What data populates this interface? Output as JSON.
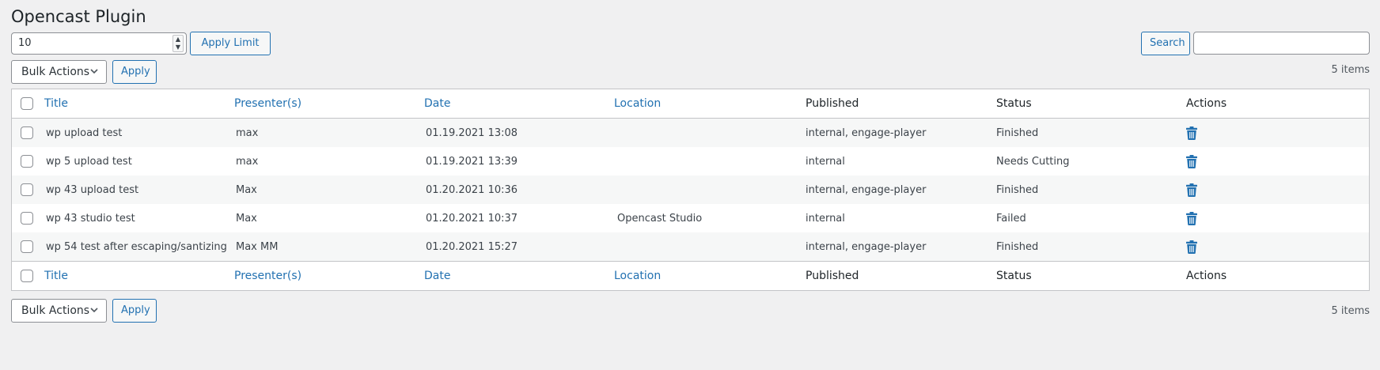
{
  "page": {
    "title": "Opencast Plugin"
  },
  "limit": {
    "value": "10",
    "apply_label": "Apply Limit"
  },
  "search": {
    "button_label": "Search",
    "value": ""
  },
  "bulk_actions": {
    "selected": "Bulk Actions",
    "apply_label": "Apply"
  },
  "items_count": "5 items",
  "table": {
    "columns": {
      "title": "Title",
      "presenters": "Presenter(s)",
      "date": "Date",
      "location": "Location",
      "published": "Published",
      "status": "Status",
      "actions": "Actions"
    },
    "rows": [
      {
        "title": "wp upload test",
        "presenters": "max",
        "date": "01.19.2021 13:08",
        "location": "",
        "published": "internal, engage-player",
        "status": "Finished"
      },
      {
        "title": "wp 5 upload test",
        "presenters": "max",
        "date": "01.19.2021 13:39",
        "location": "",
        "published": "internal",
        "status": "Needs Cutting"
      },
      {
        "title": "wp 43 upload test",
        "presenters": "Max",
        "date": "01.20.2021 10:36",
        "location": "",
        "published": "internal, engage-player",
        "status": "Finished"
      },
      {
        "title": "wp 43 studio test",
        "presenters": "Max",
        "date": "01.20.2021 10:37",
        "location": "Opencast Studio",
        "published": "internal",
        "status": "Failed"
      },
      {
        "title": "wp 54 test after escaping/santizing",
        "presenters": "Max MM",
        "date": "01.20.2021 15:27",
        "location": "",
        "published": "internal, engage-player",
        "status": "Finished"
      }
    ]
  },
  "icons": {
    "delete": "trash-icon",
    "spinner": "number-spinner-icon",
    "dropdown": "chevron-down-icon"
  },
  "colors": {
    "link": "#2271b1",
    "background": "#f0f0f1",
    "trash": "#2271b1"
  }
}
